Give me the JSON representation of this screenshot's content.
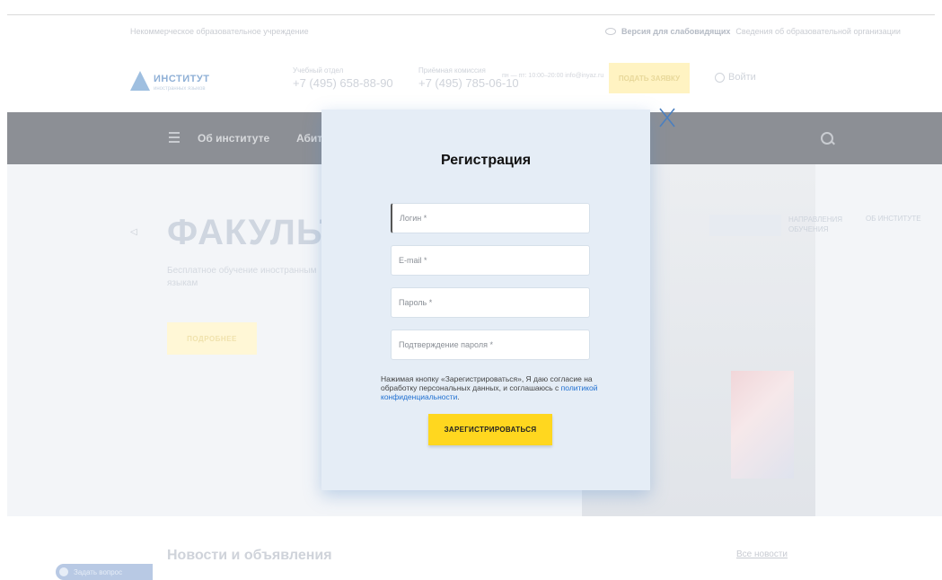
{
  "topbar": {
    "left_text": "Некоммерческое образовательное учреждение",
    "vision_label": "Версия для слабовидящих",
    "right_text": "Сведения об образовательной организации"
  },
  "header": {
    "logo_title": "ИНСТИТУТ",
    "logo_subtitle": "иностранных языков",
    "phone1_label": "Учебный отдел",
    "phone1": "+7 (495) 658-88-90",
    "phone2_label": "Приёмная комиссия",
    "phone2": "+7 (495) 785-06-10",
    "phone_extra": "пн — пт: 10:00–20:00 info@inyaz.ru",
    "apply_button": "ПОДАТЬ ЗАЯВКУ",
    "login": "Войти"
  },
  "nav": {
    "items": [
      "Об институте",
      "Абитуриентам"
    ]
  },
  "hero": {
    "title": "ФАКУЛЬТЕТ",
    "subtitle": "Бесплатное обучение иностранным языкам",
    "button": "ПОДРОБНЕЕ",
    "tab_a": "НАПРАВЛЕНИЯ ОБУЧЕНИЯ",
    "tab_b": "ОБ ИНСТИТУТЕ"
  },
  "news": {
    "title": "Новости и объявления",
    "all_link": "Все новости",
    "chip_label": "Задать вопрос"
  },
  "modal": {
    "title": "Регистрация",
    "login_placeholder": "Логин *",
    "email_placeholder": "E-mail *",
    "password_placeholder": "Пароль *",
    "confirm_placeholder": "Подтверждение пароля *",
    "agreement_text": "Нажимая кнопку «Зарегистрироваться», Я даю согласие на обработку персональных данных, и соглашаюсь с",
    "privacy_link": "политикой конфиденциальности",
    "submit": "ЗАРЕГИСТРИРОВАТЬСЯ"
  }
}
